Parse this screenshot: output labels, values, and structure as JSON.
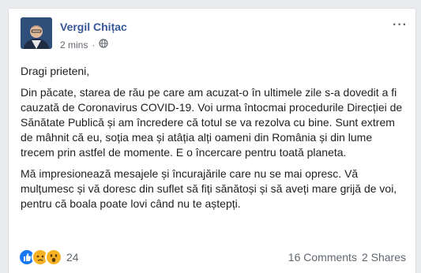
{
  "author": {
    "name": "Vergil Chițac"
  },
  "meta": {
    "time": "2 mins",
    "separator": "·",
    "audience_icon": "globe-icon"
  },
  "menu": {
    "icon": "more-options-icon",
    "label": "···"
  },
  "post": {
    "paragraphs": [
      "Dragi prieteni,",
      "Din păcate, starea de rău pe care am acuzat-o în ultimele zile s-a dovedit a fi cauzată de Coronavirus COVID-19. Voi urma întocmai procedurile Direcției de Sănătate Publică și am încredere că totul se va rezolva cu bine. Sunt extrem de mâhnit că eu, soția mea și atâția alți oameni din România și din lume trecem prin astfel de momente. E o încercare pentru toată planeta.",
      "Mă impresionează mesajele și încurajările care nu se mai opresc. Vă mulțumesc și vă doresc din suflet să fiți sănătoși și să aveți mare grijă de voi, pentru că boala poate lovi când nu te aștepți."
    ]
  },
  "footer": {
    "reactions": [
      {
        "icon": "like-reaction-icon",
        "color": "#1877f2"
      },
      {
        "icon": "sad-reaction-icon",
        "color": "#f7b125"
      },
      {
        "icon": "wow-reaction-icon",
        "color": "#f7b125"
      }
    ],
    "reaction_count": "24",
    "comments": "16 Comments",
    "shares": "2 Shares"
  }
}
